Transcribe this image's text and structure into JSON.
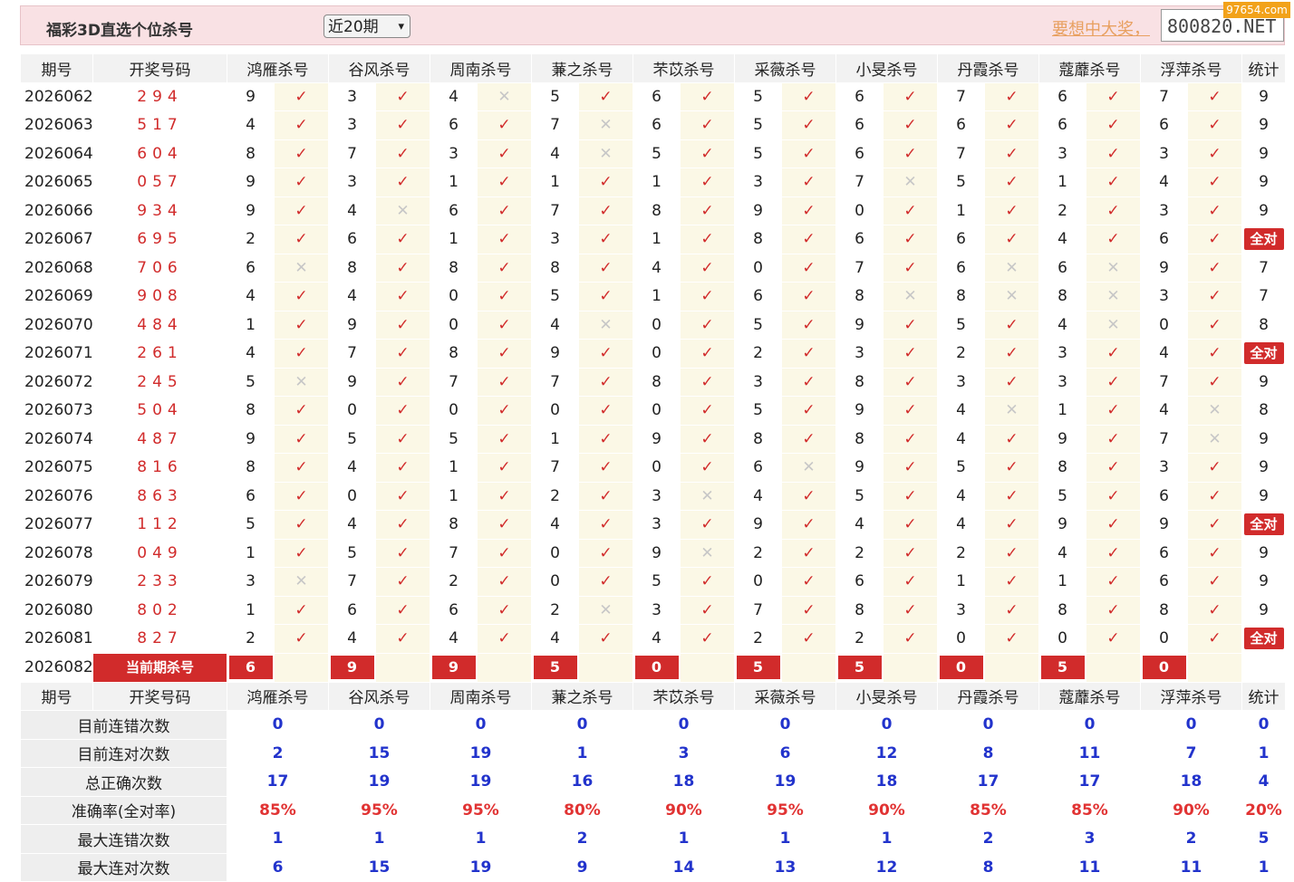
{
  "header": {
    "title": "福彩3D直选个位杀号",
    "period_select": "近20期",
    "slogan": "要想中大奖，",
    "site": "800820.NET",
    "watermark": "97654.com"
  },
  "columns": {
    "issue": "期号",
    "winning": "开奖号码",
    "experts": [
      "鸿雁杀号",
      "谷风杀号",
      "周南杀号",
      "蒹之杀号",
      "芣苡杀号",
      "采薇杀号",
      "小旻杀号",
      "丹霞杀号",
      "蔻蘼杀号",
      "浮萍杀号"
    ],
    "stat": "统计"
  },
  "rows": [
    {
      "issue": "2026062",
      "win": "294",
      "kills": [
        9,
        3,
        4,
        5,
        6,
        5,
        6,
        7,
        6,
        7
      ],
      "ok": [
        1,
        1,
        0,
        1,
        1,
        1,
        1,
        1,
        1,
        1
      ],
      "stat": "9"
    },
    {
      "issue": "2026063",
      "win": "517",
      "kills": [
        4,
        3,
        6,
        7,
        6,
        5,
        6,
        6,
        6,
        6
      ],
      "ok": [
        1,
        1,
        1,
        0,
        1,
        1,
        1,
        1,
        1,
        1
      ],
      "stat": "9"
    },
    {
      "issue": "2026064",
      "win": "604",
      "kills": [
        8,
        7,
        3,
        4,
        5,
        5,
        6,
        7,
        3,
        3
      ],
      "ok": [
        1,
        1,
        1,
        0,
        1,
        1,
        1,
        1,
        1,
        1
      ],
      "stat": "9"
    },
    {
      "issue": "2026065",
      "win": "057",
      "kills": [
        9,
        3,
        1,
        1,
        1,
        3,
        7,
        5,
        1,
        4
      ],
      "ok": [
        1,
        1,
        1,
        1,
        1,
        1,
        0,
        1,
        1,
        1
      ],
      "stat": "9"
    },
    {
      "issue": "2026066",
      "win": "934",
      "kills": [
        9,
        4,
        6,
        7,
        8,
        9,
        0,
        1,
        2,
        3
      ],
      "ok": [
        1,
        0,
        1,
        1,
        1,
        1,
        1,
        1,
        1,
        1
      ],
      "stat": "9"
    },
    {
      "issue": "2026067",
      "win": "695",
      "kills": [
        2,
        6,
        1,
        3,
        1,
        8,
        6,
        6,
        4,
        6
      ],
      "ok": [
        1,
        1,
        1,
        1,
        1,
        1,
        1,
        1,
        1,
        1
      ],
      "stat": "全对"
    },
    {
      "issue": "2026068",
      "win": "706",
      "kills": [
        6,
        8,
        8,
        8,
        4,
        0,
        7,
        6,
        6,
        9
      ],
      "ok": [
        0,
        1,
        1,
        1,
        1,
        1,
        1,
        0,
        0,
        1
      ],
      "stat": "7"
    },
    {
      "issue": "2026069",
      "win": "908",
      "kills": [
        4,
        4,
        0,
        5,
        1,
        6,
        8,
        8,
        8,
        3
      ],
      "ok": [
        1,
        1,
        1,
        1,
        1,
        1,
        0,
        0,
        0,
        1
      ],
      "stat": "7"
    },
    {
      "issue": "2026070",
      "win": "484",
      "kills": [
        1,
        9,
        0,
        4,
        0,
        5,
        9,
        5,
        4,
        0
      ],
      "ok": [
        1,
        1,
        1,
        0,
        1,
        1,
        1,
        1,
        0,
        1
      ],
      "stat": "8"
    },
    {
      "issue": "2026071",
      "win": "261",
      "kills": [
        4,
        7,
        8,
        9,
        0,
        2,
        3,
        2,
        3,
        4
      ],
      "ok": [
        1,
        1,
        1,
        1,
        1,
        1,
        1,
        1,
        1,
        1
      ],
      "stat": "全对"
    },
    {
      "issue": "2026072",
      "win": "245",
      "kills": [
        5,
        9,
        7,
        7,
        8,
        3,
        8,
        3,
        3,
        7
      ],
      "ok": [
        0,
        1,
        1,
        1,
        1,
        1,
        1,
        1,
        1,
        1
      ],
      "stat": "9"
    },
    {
      "issue": "2026073",
      "win": "504",
      "kills": [
        8,
        0,
        0,
        0,
        0,
        5,
        9,
        4,
        1,
        4
      ],
      "ok": [
        1,
        1,
        1,
        1,
        1,
        1,
        1,
        0,
        1,
        0
      ],
      "stat": "8"
    },
    {
      "issue": "2026074",
      "win": "487",
      "kills": [
        9,
        5,
        5,
        1,
        9,
        8,
        8,
        4,
        9,
        7
      ],
      "ok": [
        1,
        1,
        1,
        1,
        1,
        1,
        1,
        1,
        1,
        0
      ],
      "stat": "9"
    },
    {
      "issue": "2026075",
      "win": "816",
      "kills": [
        8,
        4,
        1,
        7,
        0,
        6,
        9,
        5,
        8,
        3
      ],
      "ok": [
        1,
        1,
        1,
        1,
        1,
        0,
        1,
        1,
        1,
        1
      ],
      "stat": "9"
    },
    {
      "issue": "2026076",
      "win": "863",
      "kills": [
        6,
        0,
        1,
        2,
        3,
        4,
        5,
        4,
        5,
        6
      ],
      "ok": [
        1,
        1,
        1,
        1,
        0,
        1,
        1,
        1,
        1,
        1
      ],
      "stat": "9"
    },
    {
      "issue": "2026077",
      "win": "112",
      "kills": [
        5,
        4,
        8,
        4,
        3,
        9,
        4,
        4,
        9,
        9
      ],
      "ok": [
        1,
        1,
        1,
        1,
        1,
        1,
        1,
        1,
        1,
        1
      ],
      "stat": "全对"
    },
    {
      "issue": "2026078",
      "win": "049",
      "kills": [
        1,
        5,
        7,
        0,
        9,
        2,
        2,
        2,
        4,
        6
      ],
      "ok": [
        1,
        1,
        1,
        1,
        0,
        1,
        1,
        1,
        1,
        1
      ],
      "stat": "9"
    },
    {
      "issue": "2026079",
      "win": "233",
      "kills": [
        3,
        7,
        2,
        0,
        5,
        0,
        6,
        1,
        1,
        6
      ],
      "ok": [
        0,
        1,
        1,
        1,
        1,
        1,
        1,
        1,
        1,
        1
      ],
      "stat": "9"
    },
    {
      "issue": "2026080",
      "win": "802",
      "kills": [
        1,
        6,
        6,
        2,
        3,
        7,
        8,
        3,
        8,
        8
      ],
      "ok": [
        1,
        1,
        1,
        0,
        1,
        1,
        1,
        1,
        1,
        1
      ],
      "stat": "9"
    },
    {
      "issue": "2026081",
      "win": "827",
      "kills": [
        2,
        4,
        4,
        4,
        4,
        2,
        2,
        0,
        0,
        0
      ],
      "ok": [
        1,
        1,
        1,
        1,
        1,
        1,
        1,
        1,
        1,
        1
      ],
      "stat": "全对"
    }
  ],
  "current": {
    "issue": "2026082",
    "label": "当前期杀号",
    "kills": [
      "6",
      "9",
      "9",
      "5",
      "0",
      "5",
      "5",
      "0",
      "5",
      "0"
    ]
  },
  "marks": {
    "ok": "✓",
    "bad": "✕"
  },
  "stats": [
    {
      "label": "目前连错次数",
      "values": [
        "0",
        "0",
        "0",
        "0",
        "0",
        "0",
        "0",
        "0",
        "0",
        "0",
        "0"
      ],
      "rate": false
    },
    {
      "label": "目前连对次数",
      "values": [
        "2",
        "15",
        "19",
        "1",
        "3",
        "6",
        "12",
        "8",
        "11",
        "7",
        "1"
      ],
      "rate": false
    },
    {
      "label": "总正确次数",
      "values": [
        "17",
        "19",
        "19",
        "16",
        "18",
        "19",
        "18",
        "17",
        "17",
        "18",
        "4"
      ],
      "rate": false
    },
    {
      "label": "准确率(全对率)",
      "values": [
        "85%",
        "95%",
        "95%",
        "80%",
        "90%",
        "95%",
        "90%",
        "85%",
        "85%",
        "90%",
        "20%"
      ],
      "rate": true
    },
    {
      "label": "最大连错次数",
      "values": [
        "1",
        "1",
        "1",
        "2",
        "1",
        "1",
        "1",
        "2",
        "3",
        "2",
        "5"
      ],
      "rate": false
    },
    {
      "label": "最大连对次数",
      "values": [
        "6",
        "15",
        "19",
        "9",
        "14",
        "13",
        "12",
        "8",
        "11",
        "11",
        "1"
      ],
      "rate": false
    }
  ],
  "colors": {
    "accent_red": "#d12b2b",
    "stat_blue": "#2233cc",
    "header_pink": "#f9e1e4"
  }
}
